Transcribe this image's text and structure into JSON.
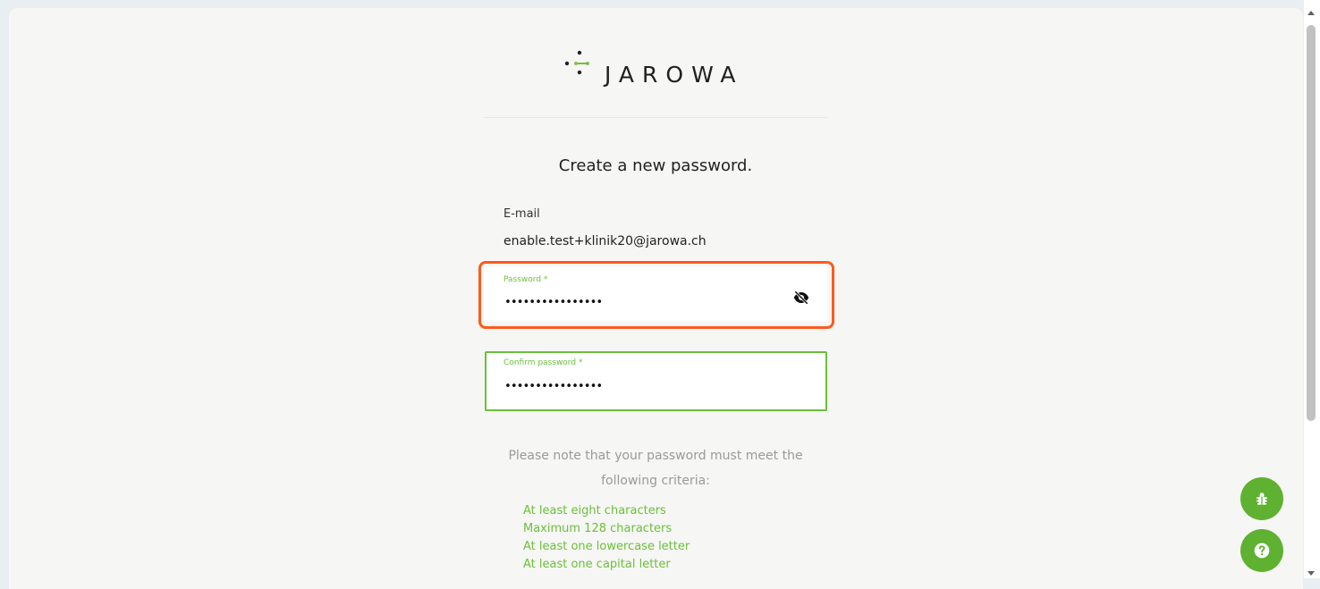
{
  "brand": {
    "name": "JAROWA"
  },
  "title": "Create a new password.",
  "email": {
    "label": "E-mail",
    "value": "enable.test+klinik20@jarowa.ch"
  },
  "password_field": {
    "label": "Password *",
    "value": "••••••••••••••••"
  },
  "confirm_field": {
    "label": "Confirm password *",
    "value": "••••••••••••••••"
  },
  "criteria": {
    "intro": "Please note that your password must meet the following criteria:",
    "items": [
      "At least eight characters",
      "Maximum 128 characters",
      "At least one lowercase letter",
      "At least one capital letter"
    ]
  },
  "fabs": {
    "bug_icon": "bug-icon",
    "help_icon": "help-icon"
  },
  "colors": {
    "accent": "#6cbf3c",
    "fab": "#5fb131",
    "focus": "#ff5a1f",
    "background": "#f6f6f4"
  }
}
